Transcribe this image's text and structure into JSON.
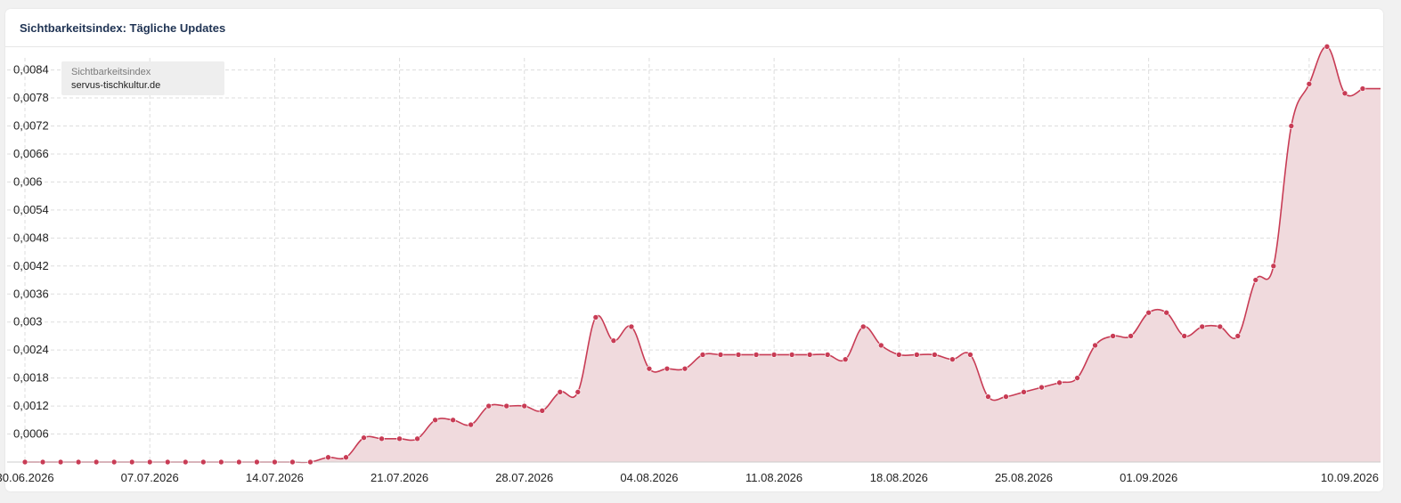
{
  "card": {
    "title": "Sichtbarkeitsindex: Tägliche Updates"
  },
  "legend": {
    "label": "Sichtbarkeitsindex",
    "domain": "servus-tischkultur.de"
  },
  "colors": {
    "line": "#c83c55",
    "fill": "#f0dadd",
    "grid": "#dddddd",
    "title": "#1f3353"
  },
  "chart_data": {
    "type": "area",
    "title": "Sichtbarkeitsindex: Tägliche Updates",
    "xlabel": "",
    "ylabel": "",
    "x_start": "30.06.2026",
    "x_end": "10.09.2026",
    "xlim": [
      "29.06.2026",
      "11.09.2026"
    ],
    "ylim": [
      0,
      0.00885
    ],
    "grid": true,
    "legend_placement": "top-left",
    "y_ticks": [
      0.0006,
      0.0012,
      0.0018,
      0.0024,
      0.003,
      0.0036,
      0.0042,
      0.0048,
      0.0054,
      0.006,
      0.0066,
      0.0072,
      0.0078,
      0.0084
    ],
    "y_tick_labels": [
      "0,0006",
      "0,0012",
      "0,0018",
      "0,0024",
      "0,003",
      "0,0036",
      "0,0042",
      "0,0048",
      "0,0054",
      "0,006",
      "0,0066",
      "0,0072",
      "0,0078",
      "0,0084"
    ],
    "x_tick_labels": [
      "30.06.2026",
      "07.07.2026",
      "14.07.2026",
      "21.07.2026",
      "28.07.2026",
      "04.08.2026",
      "11.08.2026",
      "18.08.2026",
      "25.08.2026",
      "01.09.2026",
      "10.09.2026"
    ],
    "x_tick_offsets": [
      0,
      7,
      14,
      21,
      28,
      35,
      42,
      49,
      56,
      63,
      72
    ],
    "series": [
      {
        "name": "servus-tischkultur.de",
        "values": [
          0,
          0,
          0,
          0,
          0,
          0,
          0,
          0,
          0,
          0,
          0,
          0,
          0,
          0,
          0,
          0,
          0,
          0.0001,
          0.0001,
          0.00052,
          0.0005,
          0.0005,
          0.0005,
          0.0009,
          0.0009,
          0.0008,
          0.0012,
          0.0012,
          0.0012,
          0.0011,
          0.0015,
          0.0015,
          0.0031,
          0.0026,
          0.0029,
          0.002,
          0.002,
          0.002,
          0.0023,
          0.0023,
          0.0023,
          0.0023,
          0.0023,
          0.0023,
          0.0023,
          0.0023,
          0.0022,
          0.0029,
          0.0025,
          0.0023,
          0.0023,
          0.0023,
          0.0022,
          0.0023,
          0.0014,
          0.0014,
          0.0015,
          0.0016,
          0.0017,
          0.0018,
          0.0025,
          0.0027,
          0.0027,
          0.0032,
          0.0032,
          0.0027,
          0.0029,
          0.0029,
          0.0027,
          0.0039,
          0.0042,
          0.0072,
          0.0081,
          0.0089,
          0.0079,
          0.008
        ]
      }
    ]
  }
}
